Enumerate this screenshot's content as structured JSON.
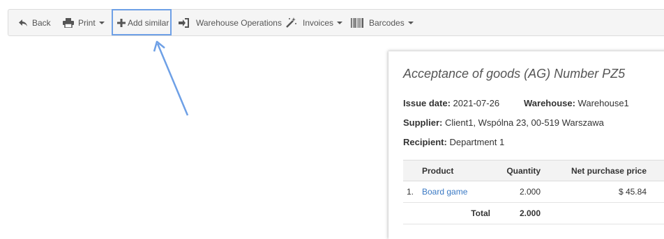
{
  "toolbar": {
    "back": "Back",
    "print": "Print",
    "add_similar": "Add similar",
    "warehouse_operations": "Warehouse Operations",
    "invoices": "Invoices",
    "barcodes": "Barcodes"
  },
  "document": {
    "title": "Acceptance of goods (AG) Number PZ5",
    "issue_date_label": "Issue date:",
    "issue_date": "2021-07-26",
    "warehouse_label": "Warehouse:",
    "warehouse": "Warehouse1",
    "supplier_label": "Supplier:",
    "supplier": "Client1, Wspólna 23, 00-519 Warszawa",
    "recipient_label": "Recipient:",
    "recipient": "Department 1"
  },
  "table": {
    "headers": {
      "product": "Product",
      "quantity": "Quantity",
      "net_price": "Net purchase price"
    },
    "rows": [
      {
        "num": "1.",
        "product": "Board game",
        "quantity": "2.000",
        "net_price": "$ 45.84"
      }
    ],
    "total_label": "Total",
    "total_quantity": "2.000"
  },
  "colors": {
    "highlight": "#6ea0e6",
    "link": "#3a79c4"
  }
}
